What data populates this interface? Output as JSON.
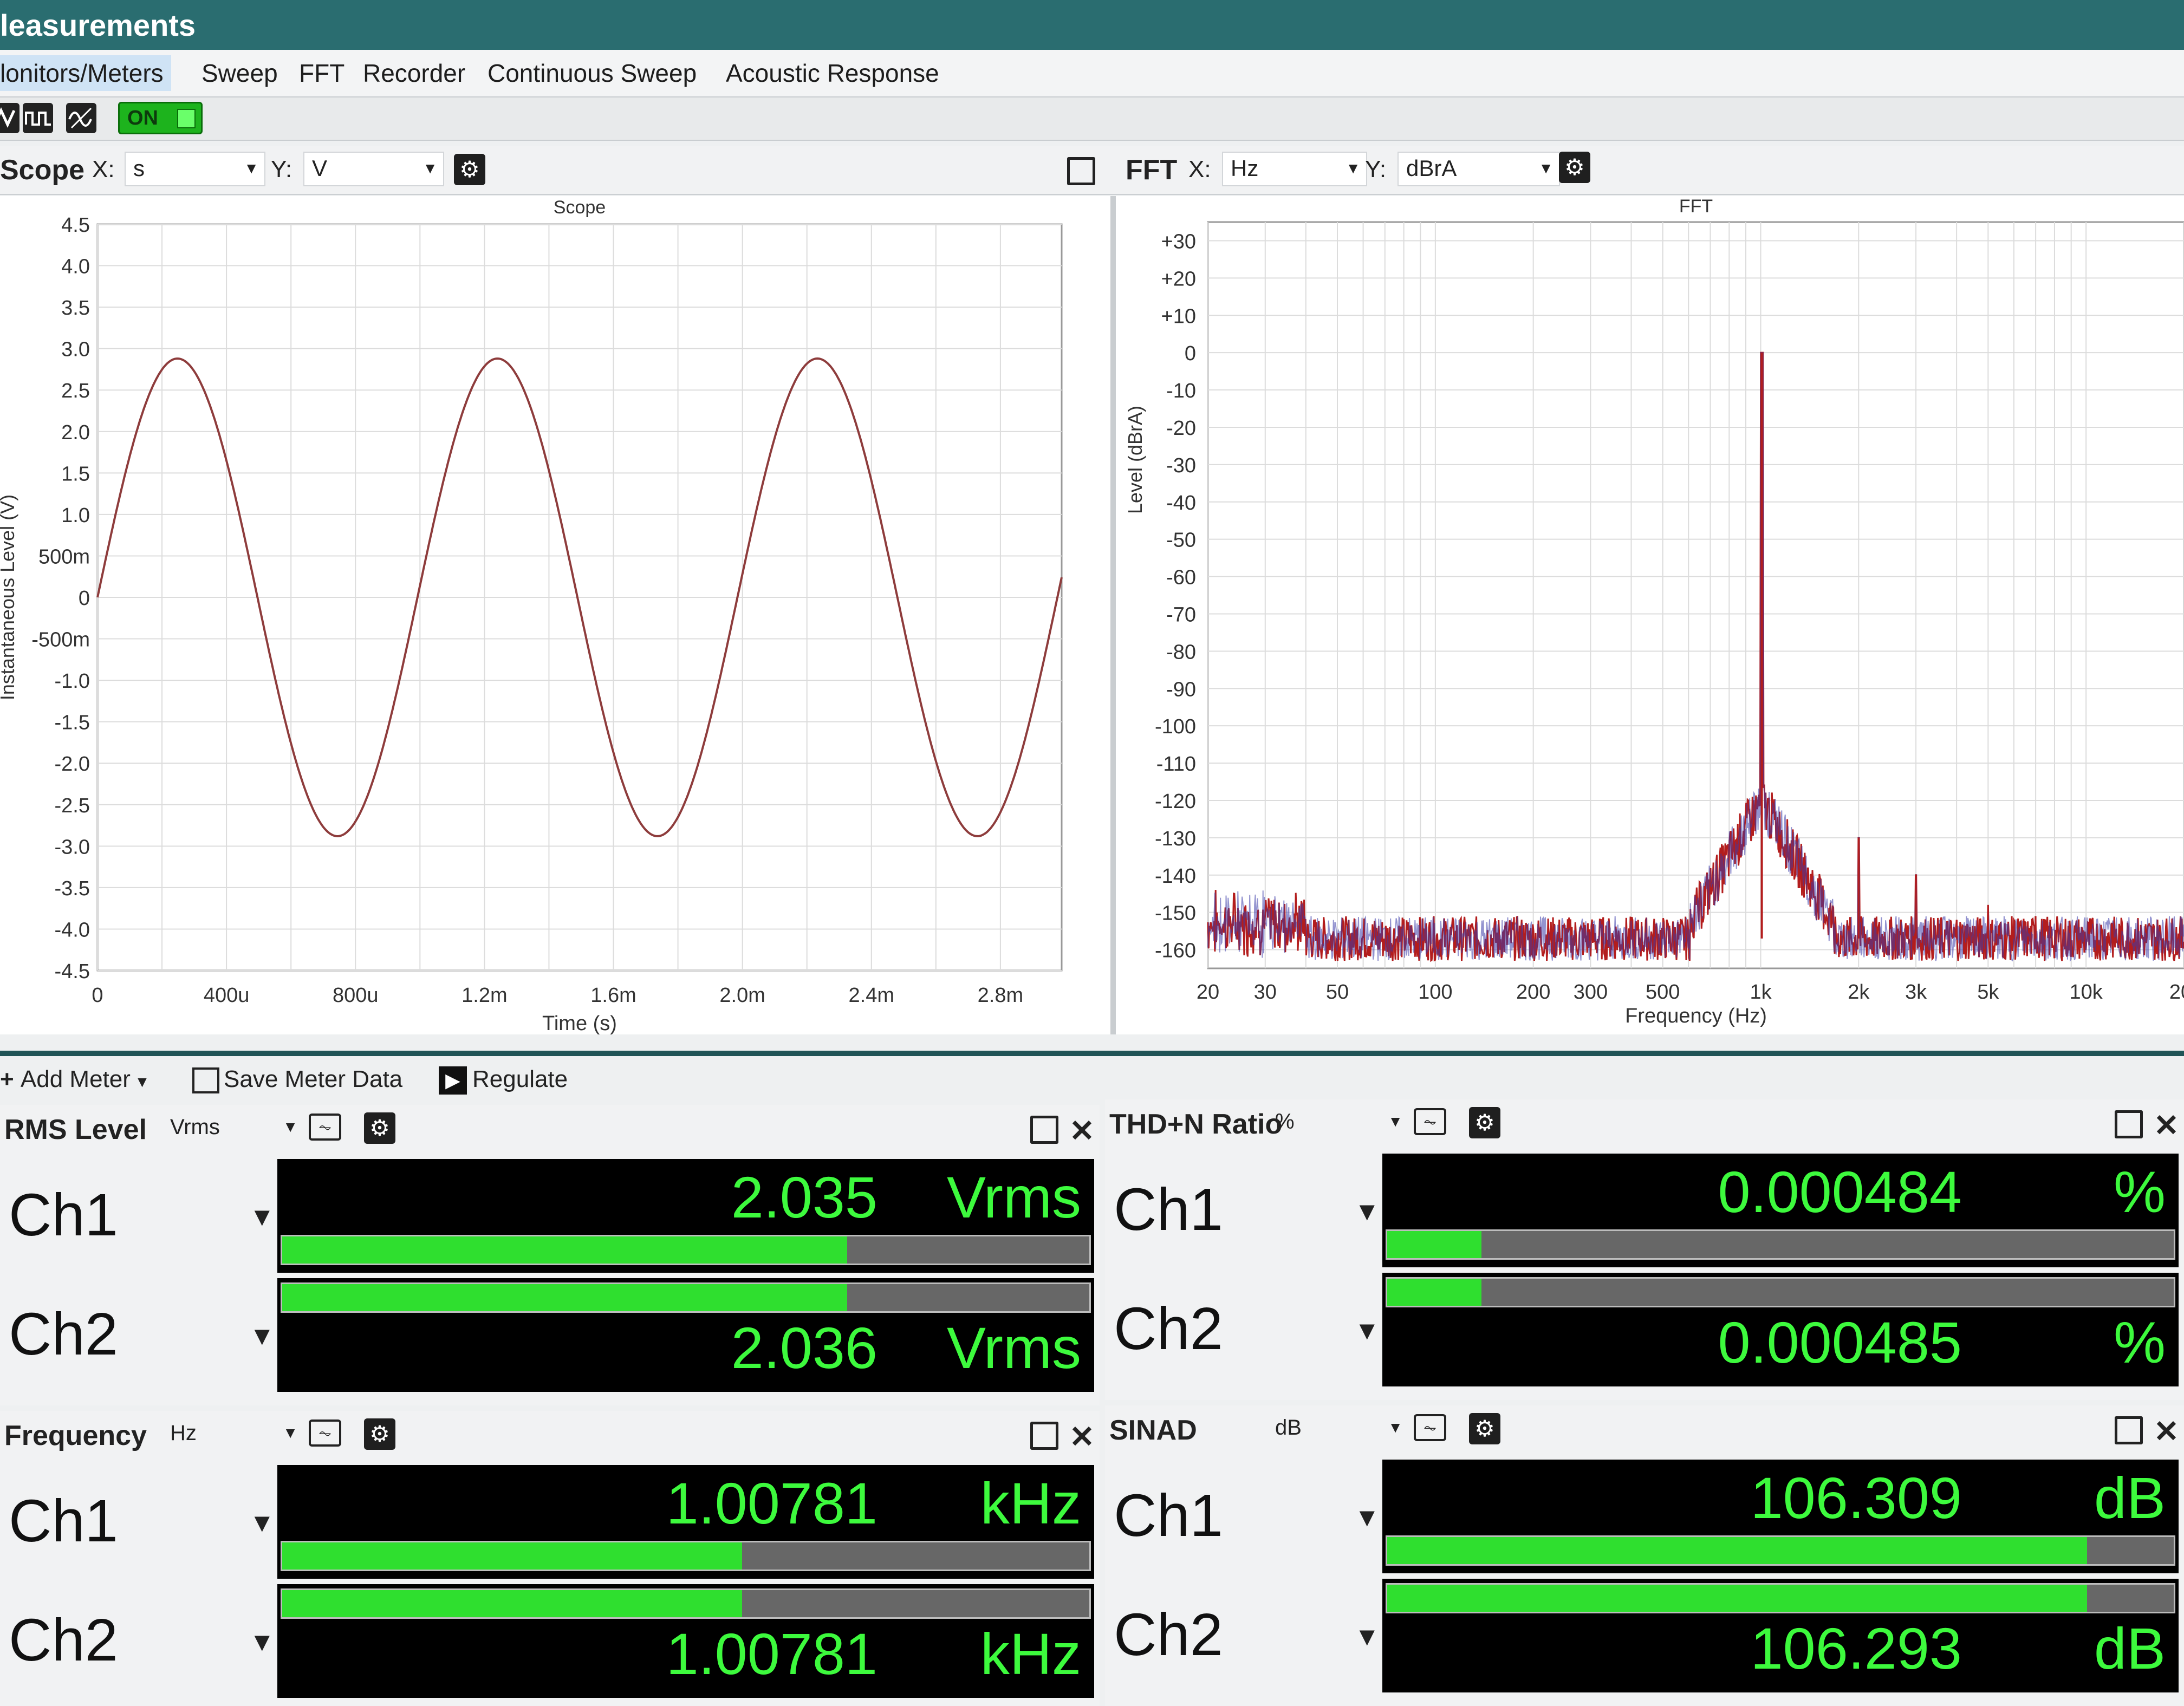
{
  "window": {
    "title": "leasurements"
  },
  "tabs": [
    {
      "label": "lonitors/Meters",
      "active": true
    },
    {
      "label": "Sweep"
    },
    {
      "label": "FFT"
    },
    {
      "label": "Recorder"
    },
    {
      "label": "Continuous Sweep"
    },
    {
      "label": "Acoustic Response"
    }
  ],
  "toolbar": {
    "on_label": "ON",
    "icons": [
      "scope-icon",
      "pulse-icon",
      "waveform-icon"
    ]
  },
  "scope_panel": {
    "title": "Scope",
    "x_label": "X:",
    "x_unit": "s",
    "y_label": "Y:",
    "y_unit": "V"
  },
  "fft_panel": {
    "title": "FFT",
    "x_label": "X:",
    "x_unit": "Hz",
    "y_label": "Y:",
    "y_unit": "dBrA"
  },
  "chart_data": [
    {
      "type": "line",
      "title": "Scope",
      "xlabel": "Time (s)",
      "ylabel": "Instantaneous Level (V)",
      "x_ticks": [
        "0",
        "400u",
        "800u",
        "1.2m",
        "1.6m",
        "2.0m",
        "2.4m",
        "2.8m"
      ],
      "y_ticks": [
        "4.5",
        "4.0",
        "3.5",
        "3.0",
        "2.5",
        "2.0",
        "1.5",
        "1.0",
        "500m",
        "0",
        "-500m",
        "-1.0",
        "-1.5",
        "-2.0",
        "-2.5",
        "-3.0",
        "-3.5",
        "-4.0",
        "-4.5"
      ],
      "xlim": [
        0,
        0.00299
      ],
      "ylim": [
        -4.5,
        4.5
      ],
      "series": [
        {
          "color": "#8e3c3c",
          "signal": "sine",
          "amplitude": 2.88,
          "frequency_hz": 1007.81,
          "x": [
            0,
            0.0003,
            0.00075,
            0.0012,
            0.0017,
            0.0022,
            0.0027,
            0.00299
          ],
          "y": [
            0,
            2.88,
            -2.88,
            2.88,
            -2.88,
            2.88,
            -2.88,
            0.0
          ]
        }
      ],
      "grid": true
    },
    {
      "type": "line",
      "title": "FFT",
      "xlabel": "Frequency (Hz)",
      "ylabel": "Level (dBrA)",
      "x_scale": "log",
      "xlim": [
        20,
        20000
      ],
      "ylim": [
        -165,
        35
      ],
      "x_ticks": [
        "20",
        "30",
        "50",
        "100",
        "200",
        "300",
        "500",
        "1k",
        "2k",
        "3k",
        "5k",
        "10k",
        "20"
      ],
      "y_ticks": [
        "+30",
        "+20",
        "+10",
        "0",
        "-10",
        "-20",
        "-30",
        "-40",
        "-50",
        "-60",
        "-70",
        "-80",
        "-90",
        "-100",
        "-110",
        "-120",
        "-130",
        "-140",
        "-150",
        "-160"
      ],
      "fundamental": {
        "x": 1007.81,
        "y": 0
      },
      "harmonics": [
        {
          "x": 2000,
          "y": -130
        },
        {
          "x": 3000,
          "y": -140
        },
        {
          "x": 4000,
          "y": -152
        },
        {
          "x": 5000,
          "y": -148
        },
        {
          "x": 6000,
          "y": -152
        },
        {
          "x": 7000,
          "y": -151
        },
        {
          "x": 12000,
          "y": -153
        }
      ],
      "noise_floor_db": -157,
      "series_colors": [
        "#b31d1d",
        "#3a3aa8"
      ],
      "grid": true
    }
  ],
  "meter_toolbar": {
    "add_meter": "Add Meter",
    "save_meter_data": "Save Meter Data",
    "regulate": "Regulate"
  },
  "meters": [
    {
      "title": "RMS Level",
      "unit_select": "Vrms",
      "channels": [
        {
          "name": "Ch1",
          "value": "2.035",
          "unit": "Vrms",
          "bar_fraction": 0.7
        },
        {
          "name": "Ch2",
          "value": "2.036",
          "unit": "Vrms",
          "bar_fraction": 0.7
        }
      ]
    },
    {
      "title": "THD+N Ratio",
      "unit_select": "%",
      "channels": [
        {
          "name": "Ch1",
          "value": "0.000484",
          "unit": "%",
          "bar_fraction": 0.12
        },
        {
          "name": "Ch2",
          "value": "0.000485",
          "unit": "%",
          "bar_fraction": 0.12
        }
      ]
    },
    {
      "title": "Frequency",
      "unit_select": "Hz",
      "channels": [
        {
          "name": "Ch1",
          "value": "1.00781",
          "unit": "kHz",
          "bar_fraction": 0.57
        },
        {
          "name": "Ch2",
          "value": "1.00781",
          "unit": "kHz",
          "bar_fraction": 0.57
        }
      ]
    },
    {
      "title": "SINAD",
      "unit_select": "dB",
      "channels": [
        {
          "name": "Ch1",
          "value": "106.309",
          "unit": "dB",
          "bar_fraction": 0.89
        },
        {
          "name": "Ch2",
          "value": "106.293",
          "unit": "dB",
          "bar_fraction": 0.89
        }
      ]
    }
  ]
}
